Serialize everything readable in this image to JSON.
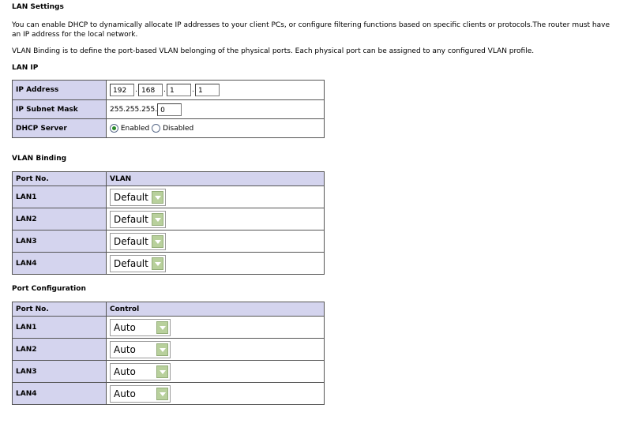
{
  "page": {
    "title": "LAN Settings",
    "intro": "You can enable DHCP to dynamically allocate IP addresses to your client PCs, or configure filtering functions based on specific clients or protocols.The router must have an IP address for the local network.",
    "vlan_intro": "VLAN Binding is to define the port-based VLAN belonging of the physical ports. Each physical port can be assigned to any configured VLAN profile."
  },
  "lan_ip": {
    "section_title": "LAN IP",
    "ip_address_label": "IP Address",
    "ip_octets": [
      "192",
      "168",
      "1",
      "1"
    ],
    "subnet_mask_label": "IP Subnet Mask",
    "subnet_prefix": "255.255.255.",
    "subnet_last": "0",
    "dhcp_label": "DHCP Server",
    "dhcp_enabled_label": "Enabled",
    "dhcp_disabled_label": "Disabled",
    "dhcp_value": "Enabled"
  },
  "vlan_binding": {
    "section_title": "VLAN Binding",
    "col_port": "Port No.",
    "col_vlan": "VLAN",
    "rows": [
      {
        "port": "LAN1",
        "vlan": "Default"
      },
      {
        "port": "LAN2",
        "vlan": "Default"
      },
      {
        "port": "LAN3",
        "vlan": "Default"
      },
      {
        "port": "LAN4",
        "vlan": "Default"
      }
    ]
  },
  "port_config": {
    "section_title": "Port Configuration",
    "col_port": "Port No.",
    "col_control": "Control",
    "rows": [
      {
        "port": "LAN1",
        "control": "Auto"
      },
      {
        "port": "LAN2",
        "control": "Auto"
      },
      {
        "port": "LAN3",
        "control": "Auto"
      },
      {
        "port": "LAN4",
        "control": "Auto"
      }
    ]
  },
  "colors": {
    "header_bg": "#d4d4ee",
    "border": "#555555",
    "select_arrow": "#b8d09c"
  }
}
